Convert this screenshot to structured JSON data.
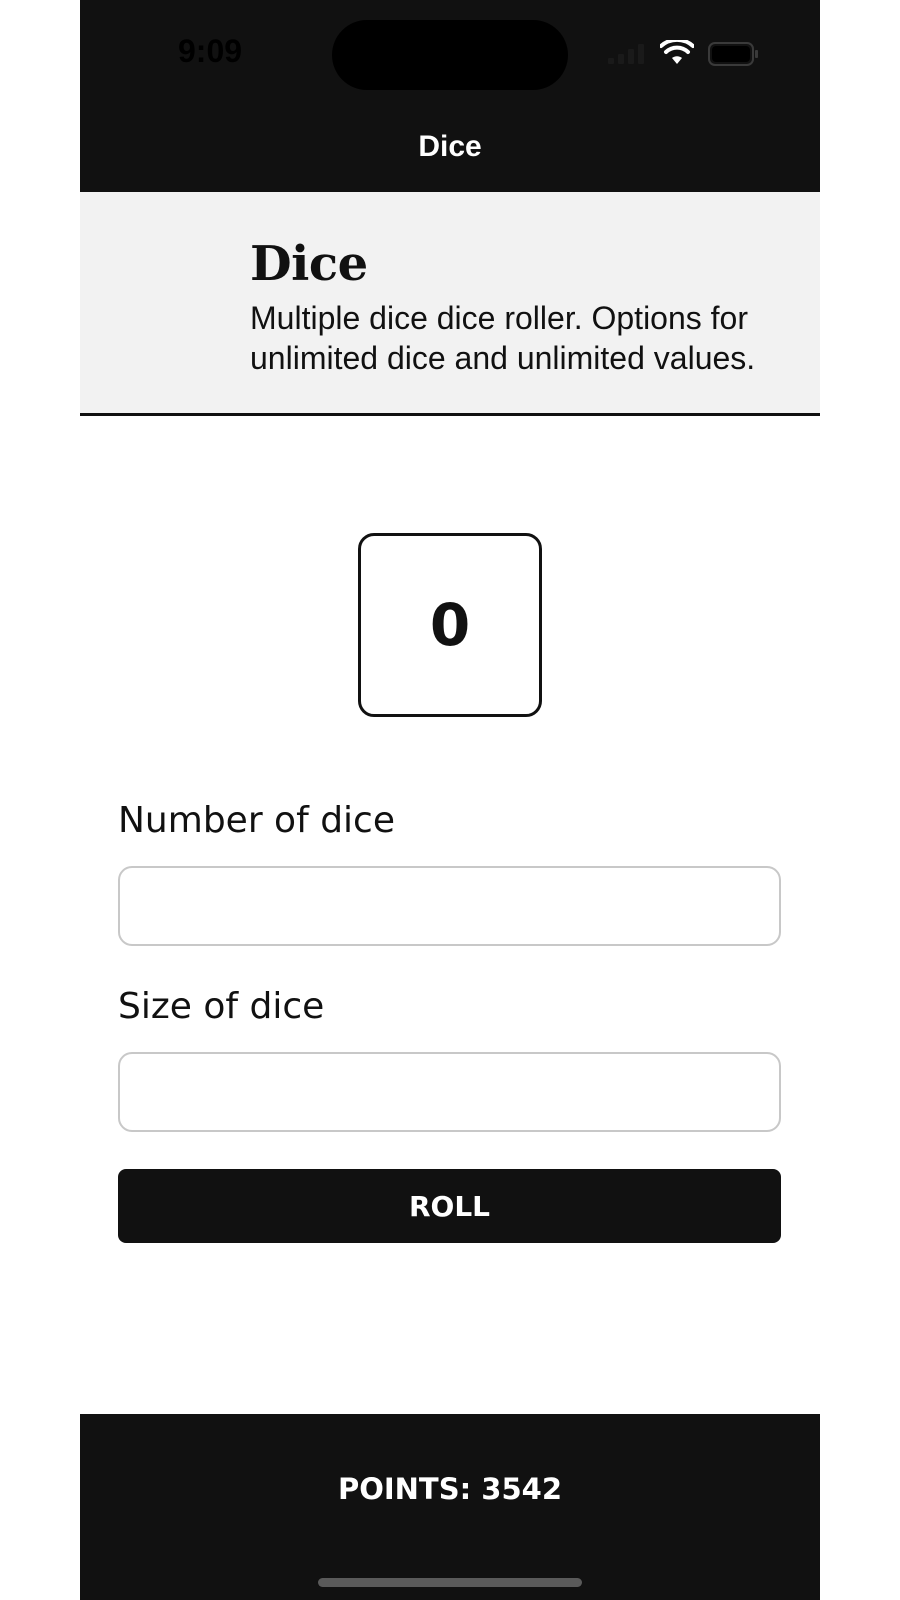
{
  "status_bar": {
    "time": "9:09",
    "icons": [
      "cellular-signal-icon",
      "wifi-icon",
      "battery-icon"
    ]
  },
  "nav": {
    "title": "Dice"
  },
  "header": {
    "title": "Dice",
    "description": "Multiple dice dice roller. Options for unlimited dice and unlimited values."
  },
  "die": {
    "value": "0"
  },
  "form": {
    "number_label": "Number of dice",
    "number_value": "",
    "size_label": "Size of dice",
    "size_value": "",
    "roll_label": "ROLL"
  },
  "footer": {
    "points": "POINTS: 3542"
  },
  "colors": {
    "bar_background": "#111111",
    "header_background": "#f2f2f2",
    "input_border": "#c8c8c8"
  }
}
